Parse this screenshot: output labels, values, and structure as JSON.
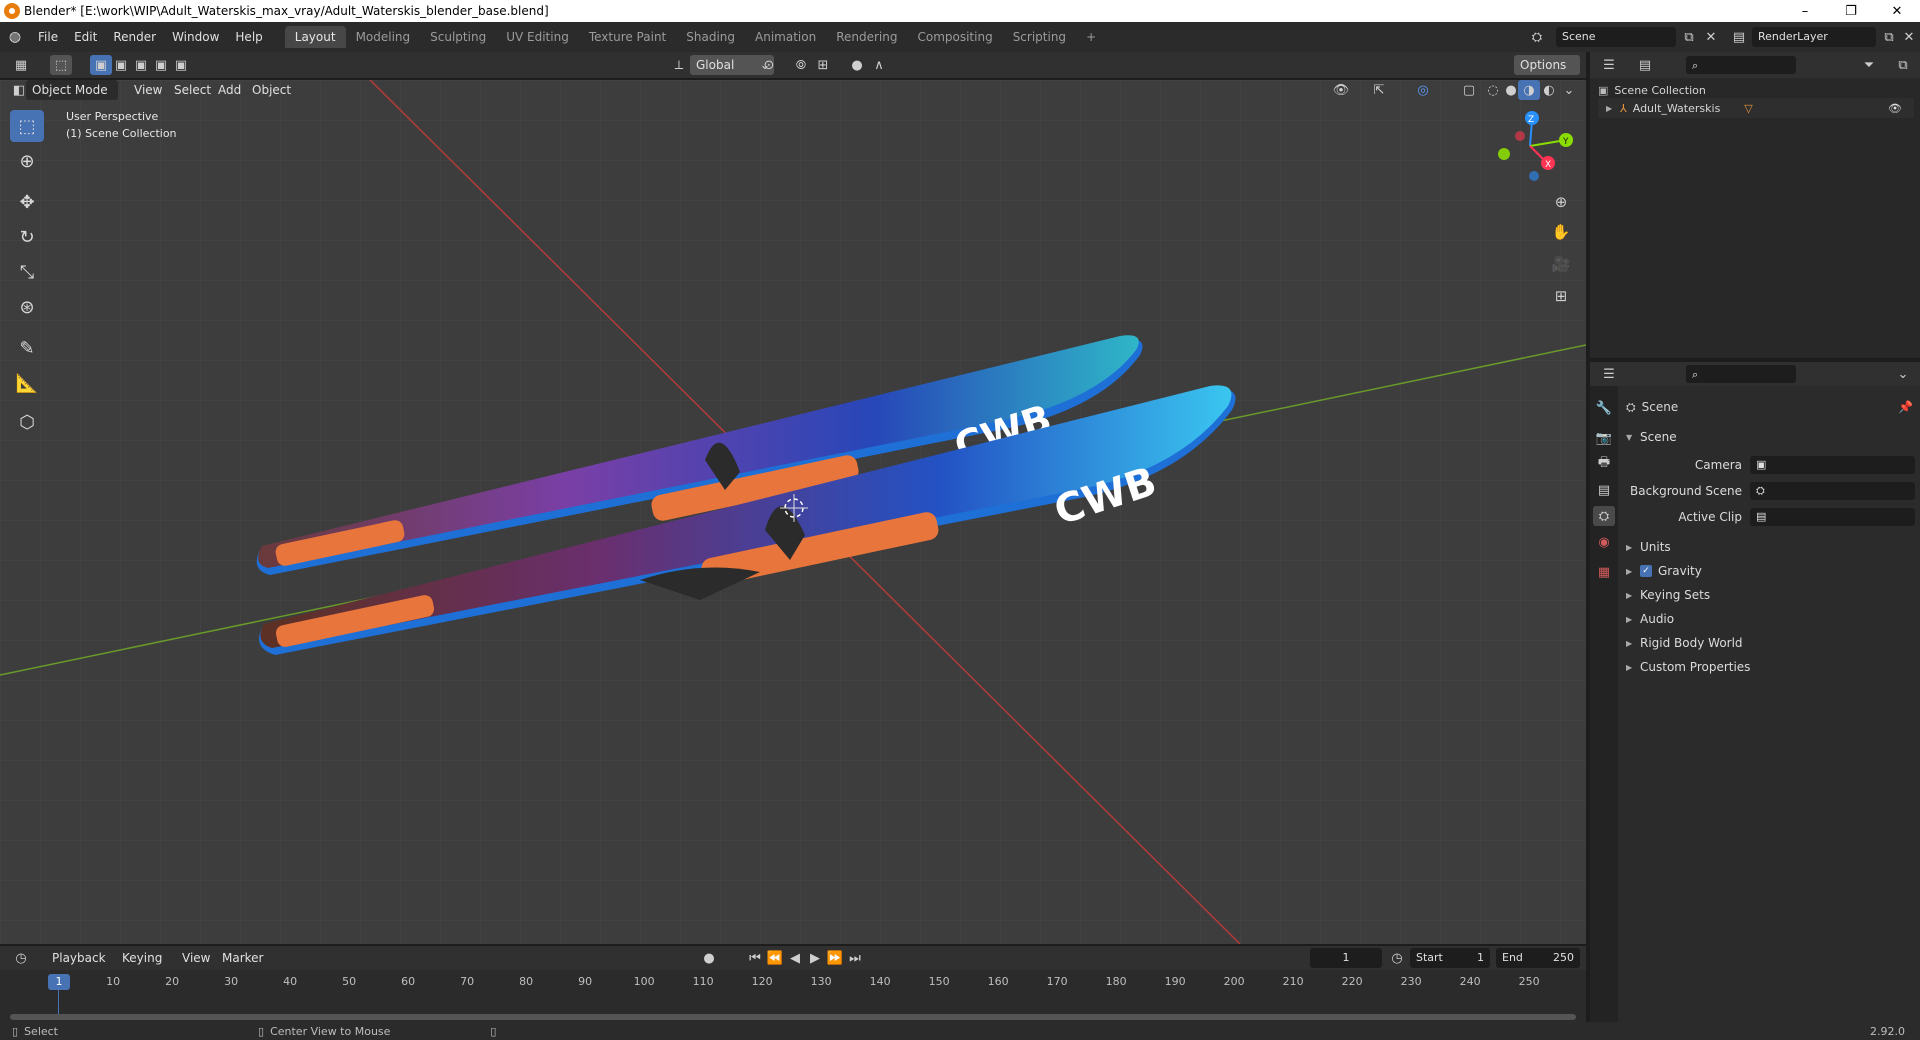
{
  "window": {
    "title": "Blender* [E:\\work\\WIP\\Adult_Waterskis_max_vray/Adult_Waterskis_blender_base.blend]",
    "minimize": "–",
    "maximize": "❐",
    "close": "✕"
  },
  "menubar": {
    "items": [
      "File",
      "Edit",
      "Render",
      "Window",
      "Help"
    ],
    "workspaces": [
      "Layout",
      "Modeling",
      "Sculpting",
      "UV Editing",
      "Texture Paint",
      "Shading",
      "Animation",
      "Rendering",
      "Compositing",
      "Scripting"
    ],
    "add_workspace": "+",
    "scene_name": "Scene",
    "render_layer": "RenderLayer"
  },
  "viewport_header": {
    "mode": "Object Mode",
    "menus": [
      "View",
      "Select",
      "Add",
      "Object"
    ],
    "transform_orientation": "Global",
    "options": "Options"
  },
  "viewport": {
    "perspective_label": "User Perspective",
    "collection_label": "(1) Scene Collection",
    "gizmo": {
      "z": "Z",
      "y": "Y",
      "x": "X"
    }
  },
  "outliner": {
    "root": "Scene Collection",
    "objects": [
      {
        "name": "Adult_Waterskis"
      }
    ]
  },
  "properties": {
    "context": "Scene",
    "section": "Scene",
    "fields": [
      {
        "label": "Camera"
      },
      {
        "label": "Background Scene"
      },
      {
        "label": "Active Clip"
      }
    ],
    "panels": [
      {
        "label": "Units",
        "checkbox": false
      },
      {
        "label": "Gravity",
        "checkbox": true
      },
      {
        "label": "Keying Sets",
        "checkbox": false
      },
      {
        "label": "Audio",
        "checkbox": false
      },
      {
        "label": "Rigid Body World",
        "checkbox": false
      },
      {
        "label": "Custom Properties",
        "checkbox": false
      }
    ]
  },
  "timeline": {
    "menus": [
      "Playback",
      "Keying",
      "View",
      "Marker"
    ],
    "current_frame": "1",
    "start_label": "Start",
    "start_value": "1",
    "end_label": "End",
    "end_value": "250",
    "ticks": [
      "10",
      "20",
      "30",
      "40",
      "50",
      "60",
      "70",
      "80",
      "90",
      "100",
      "110",
      "120",
      "130",
      "140",
      "150",
      "160",
      "170",
      "180",
      "190",
      "200",
      "210",
      "220",
      "230",
      "240",
      "250"
    ],
    "playhead_label": "1"
  },
  "statusbar": {
    "select": "Select",
    "center_view": "Center View to Mouse",
    "version": "2.92.0"
  },
  "colors": {
    "accent": "#4772b3",
    "x_axis": "#ff3352",
    "y_axis": "#8bdc00",
    "z_axis": "#2890ff",
    "ski_blue": "#1e6fd6",
    "binding_orange": "#e8763c"
  }
}
